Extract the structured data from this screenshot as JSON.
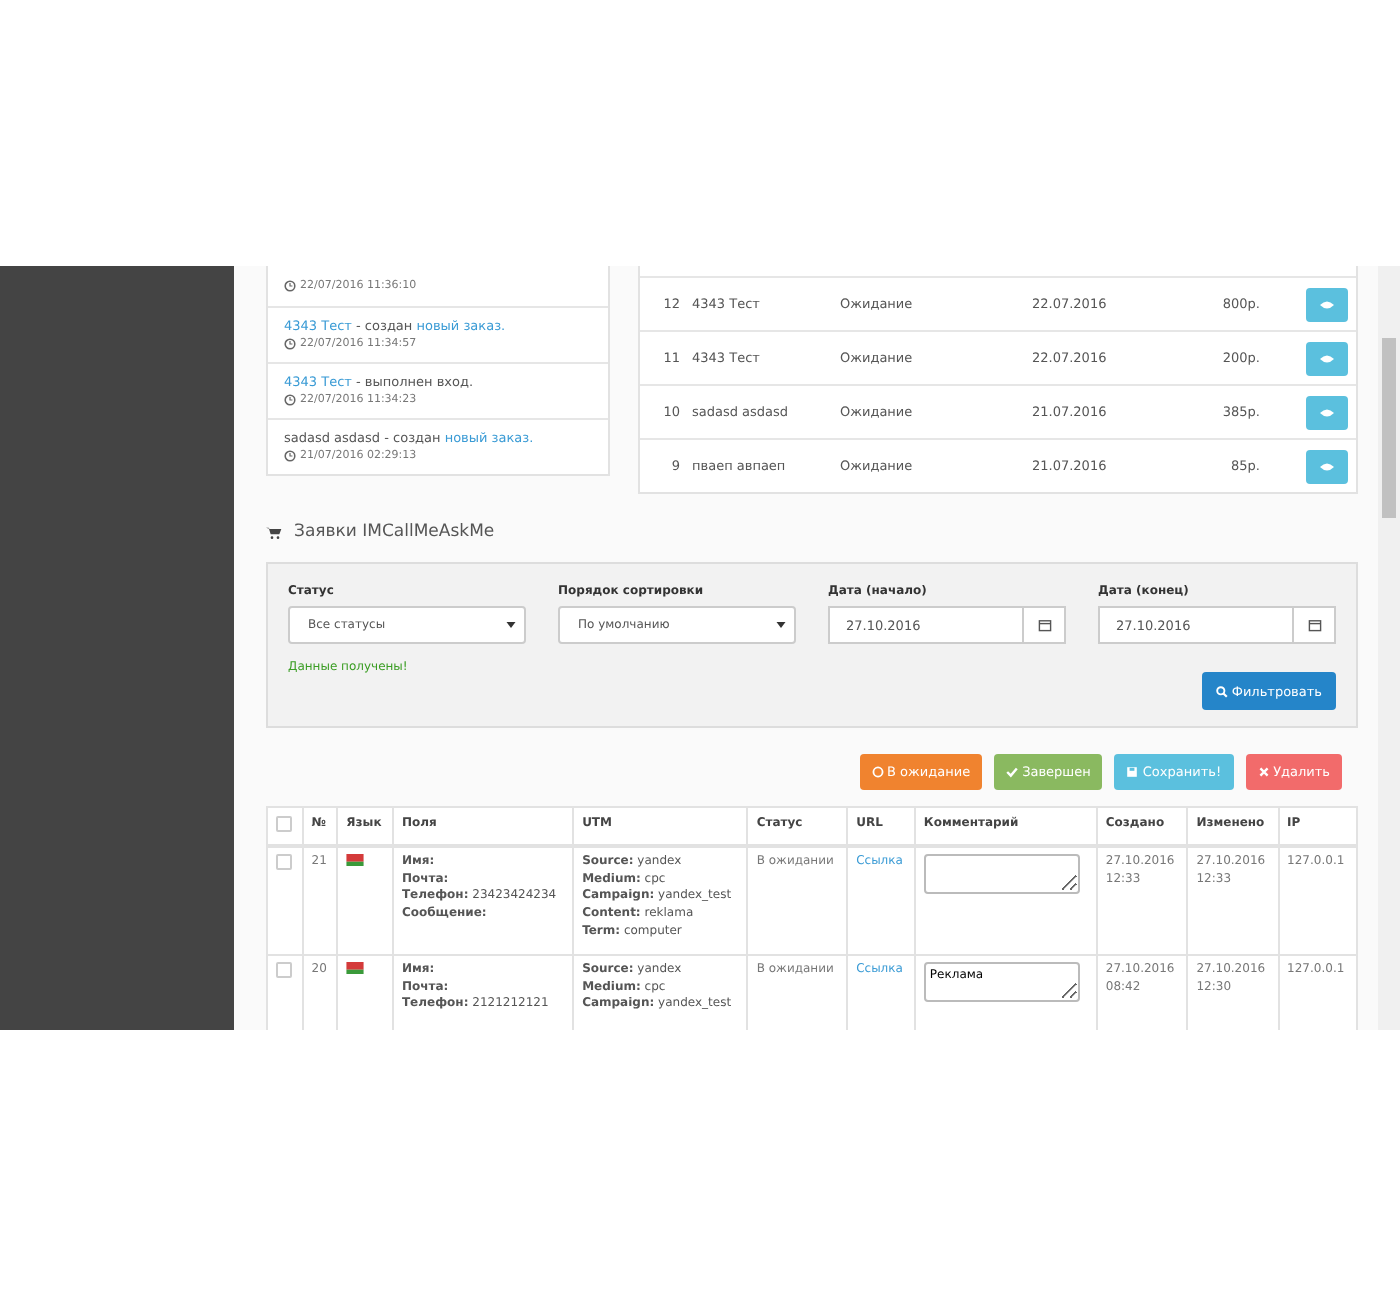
{
  "activity": [
    {
      "time": "22/07/2016 11:36:10"
    },
    {
      "parts": [
        {
          "text": "4343 Тест",
          "link": true
        },
        {
          "text": " - создан ",
          "link": false
        },
        {
          "text": "новый заказ.",
          "link": true
        }
      ],
      "time": "22/07/2016 11:34:57"
    },
    {
      "parts": [
        {
          "text": "4343 Тест",
          "link": true
        },
        {
          "text": " - выполнен вход.",
          "link": false
        }
      ],
      "time": "22/07/2016 11:34:23"
    },
    {
      "parts": [
        {
          "text": "sadasd asdasd - создан ",
          "link": false
        },
        {
          "text": "новый заказ.",
          "link": true
        }
      ],
      "time": "21/07/2016 02:29:13"
    }
  ],
  "orders": [
    {
      "id": "12",
      "name": "4343 Тест",
      "status": "Ожидание",
      "date": "22.07.2016",
      "sum": "800р."
    },
    {
      "id": "11",
      "name": "4343 Тест",
      "status": "Ожидание",
      "date": "22.07.2016",
      "sum": "200р."
    },
    {
      "id": "10",
      "name": "sadasd asdasd",
      "status": "Ожидание",
      "date": "21.07.2016",
      "sum": "385р."
    },
    {
      "id": "9",
      "name": "пваеп авпаеп",
      "status": "Ожидание",
      "date": "21.07.2016",
      "sum": "85р."
    }
  ],
  "section_title": "Заявки IMCallMeAskMe",
  "filters": [
    {
      "kind": "select",
      "label": "Статус",
      "value": "Все статусы"
    },
    {
      "kind": "select",
      "label": "Порядок сортировки",
      "value": "По умолчанию"
    },
    {
      "kind": "date",
      "label": "Дата (начало)",
      "value": "27.10.2016"
    },
    {
      "kind": "date",
      "label": "Дата (конец)",
      "value": "27.10.2016"
    }
  ],
  "status_message": "Данные получены!",
  "filter_button": "Фильтровать",
  "actions": [
    {
      "kind": "pending",
      "label": "В ожидание",
      "color": "#f0832f"
    },
    {
      "kind": "done",
      "label": "Завершен",
      "color": "#8ab960"
    },
    {
      "kind": "save",
      "label": "Сохранить!",
      "color": "#5bc0de"
    },
    {
      "kind": "delete",
      "label": "Удалить",
      "color": "#f26b6b"
    }
  ],
  "select_all_checked": false,
  "columns": [
    "№",
    "Язык",
    "Поля",
    "UTM",
    "Статус",
    "URL",
    "Комментарий",
    "Создано",
    "Изменено",
    "IP"
  ],
  "requests": [
    {
      "checked": false,
      "id": "21",
      "fields": [
        "**Имя:**",
        "**Почта:**",
        "**Телефон:** 23423424234",
        "**Сообщение:**"
      ],
      "utm": [
        "**Source:** yandex",
        "**Medium:** cpc",
        "**Campaign:** yandex_test",
        "**Content:** reklama",
        "**Term:** computer"
      ],
      "status": "В ожидании",
      "url": "Ссылка",
      "created": [
        "27.10.2016",
        "12:33"
      ],
      "modified": [
        "27.10.2016",
        "12:33"
      ],
      "ip": "127.0.0.1"
    },
    {
      "checked": false,
      "id": "20",
      "fields": [
        "**Имя:**",
        "**Почта:**",
        "**Телефон:** 2121212121"
      ],
      "utm": [
        "**Source:** yandex",
        "**Medium:** cpc",
        "**Campaign:** yandex_test"
      ],
      "status": "В ожидании",
      "url": "Ссылка",
      "comment": "Реклама",
      "created": [
        "27.10.2016",
        "08:42"
      ],
      "modified": [
        "27.10.2016",
        "12:30"
      ],
      "ip": "127.0.0.1"
    }
  ]
}
